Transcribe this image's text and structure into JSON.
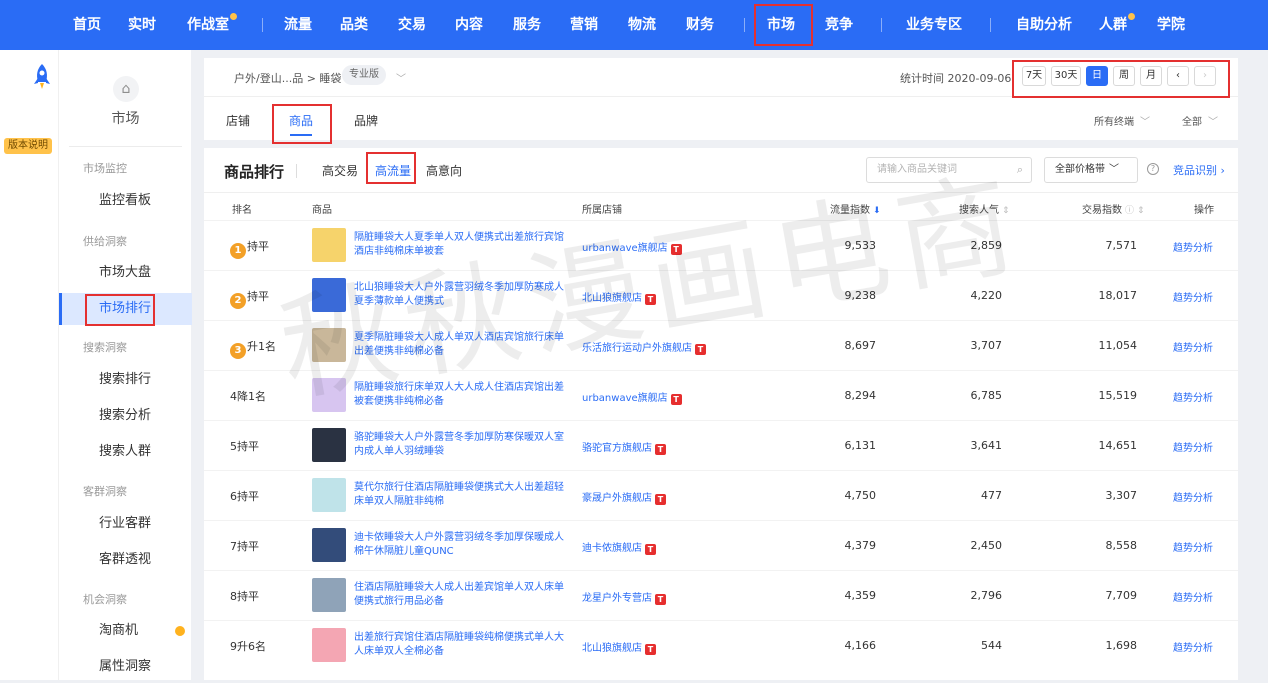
{
  "topnav": {
    "items": [
      "首页",
      "实时",
      "作战室",
      "流量",
      "品类",
      "交易",
      "内容",
      "服务",
      "营销",
      "物流",
      "财务",
      "市场",
      "竞争",
      "业务专区",
      "自助分析",
      "人群",
      "学院"
    ]
  },
  "rail": {
    "version_tag": "版本说明"
  },
  "sidebar": {
    "title": "市场",
    "groups": [
      {
        "label": "市场监控",
        "items": [
          "监控看板"
        ]
      },
      {
        "label": "供给洞察",
        "items": [
          "市场大盘",
          "市场排行"
        ]
      },
      {
        "label": "搜索洞察",
        "items": [
          "搜索排行",
          "搜索分析",
          "搜索人群"
        ]
      },
      {
        "label": "客群洞察",
        "items": [
          "行业客群",
          "客群透视"
        ]
      },
      {
        "label": "机会洞察",
        "items": [
          "淘商机",
          "属性洞察"
        ]
      }
    ]
  },
  "header": {
    "breadcrumb": "户外/登山...品 > 睡袋",
    "edition": "专业版",
    "stat_time": "统计时间 2020-09-06",
    "date_buttons": [
      "7天",
      "30天",
      "日",
      "周",
      "月",
      "‹",
      "›"
    ],
    "tabs": [
      "店铺",
      "商品",
      "品牌"
    ],
    "filters": [
      "所有终端",
      "全部"
    ]
  },
  "ranking": {
    "title": "商品排行",
    "tabs": [
      "高交易",
      "高流量",
      "高意向"
    ],
    "search_placeholder": "请输入商品关键词",
    "price_filter": "全部价格带",
    "compete_link": "竞品识别 ›",
    "columns": [
      "排名",
      "商品",
      "所属店铺",
      "流量指数",
      "搜索人气",
      "交易指数",
      "操作"
    ],
    "rows": [
      {
        "rank": "持平",
        "medal": "1",
        "product": "隔脏睡袋大人夏季单人双人便携式出差旅行宾馆酒店非纯棉床单被套",
        "shop": "urbanwave旗舰店",
        "tmall": "T",
        "traffic": "9,533",
        "search": "2,859",
        "trade": "7,571",
        "action": "趋势分析"
      },
      {
        "rank": "持平",
        "medal": "2",
        "product": "北山狼睡袋大人户外露营羽绒冬季加厚防寒成人夏季薄款单人便携式",
        "shop": "北山狼旗舰店",
        "tmall": "T",
        "traffic": "9,238",
        "search": "4,220",
        "trade": "18,017",
        "action": "趋势分析"
      },
      {
        "rank": "升1名",
        "medal": "3",
        "product": "夏季隔脏睡袋大人成人单双人酒店宾馆旅行床单出差便携非纯棉必备",
        "shop": "乐活旅行运动户外旗舰店",
        "tmall": "T",
        "traffic": "8,697",
        "search": "3,707",
        "trade": "11,054",
        "action": "趋势分析"
      },
      {
        "rank": "4降1名",
        "medal": "",
        "product": "隔脏睡袋旅行床单双人大人成人住酒店宾馆出差被套便携非纯棉必备",
        "shop": "urbanwave旗舰店",
        "tmall": "T",
        "traffic": "8,294",
        "search": "6,785",
        "trade": "15,519",
        "action": "趋势分析"
      },
      {
        "rank": "5持平",
        "medal": "",
        "product": "骆驼睡袋大人户外露营冬季加厚防寒保暖双人室内成人单人羽绒睡袋",
        "shop": "骆驼官方旗舰店",
        "tmall": "T",
        "traffic": "6,131",
        "search": "3,641",
        "trade": "14,651",
        "action": "趋势分析"
      },
      {
        "rank": "6持平",
        "medal": "",
        "product": "莫代尔旅行住酒店隔脏睡袋便携式大人出差超轻床单双人隔脏非纯棉",
        "shop": "豪晟户外旗舰店",
        "tmall": "T",
        "traffic": "4,750",
        "search": "477",
        "trade": "3,307",
        "action": "趋势分析"
      },
      {
        "rank": "7持平",
        "medal": "",
        "product": "迪卡侬睡袋大人户外露营羽绒冬季加厚保暖成人棉午休隔脏儿童QUNC",
        "shop": "迪卡侬旗舰店",
        "tmall": "T",
        "traffic": "4,379",
        "search": "2,450",
        "trade": "8,558",
        "action": "趋势分析"
      },
      {
        "rank": "8持平",
        "medal": "",
        "product": "住酒店隔脏睡袋大人成人出差宾馆单人双人床单便携式旅行用品必备",
        "shop": "龙星户外专营店",
        "tmall": "T",
        "traffic": "4,359",
        "search": "2,796",
        "trade": "7,709",
        "action": "趋势分析"
      },
      {
        "rank": "9升6名",
        "medal": "",
        "product": "出差旅行宾馆住酒店隔脏睡袋纯棉便携式单人大人床单双人全棉必备",
        "shop": "北山狼旗舰店",
        "tmall": "T",
        "traffic": "4,166",
        "search": "544",
        "trade": "1,698",
        "action": "趋势分析"
      }
    ]
  },
  "watermark": "秋秋漫画电商",
  "colors": {
    "primary": "#2a6cf5",
    "highlight": "#e43030",
    "badge": "#ffc24a",
    "tmall": "#e62e2e"
  }
}
